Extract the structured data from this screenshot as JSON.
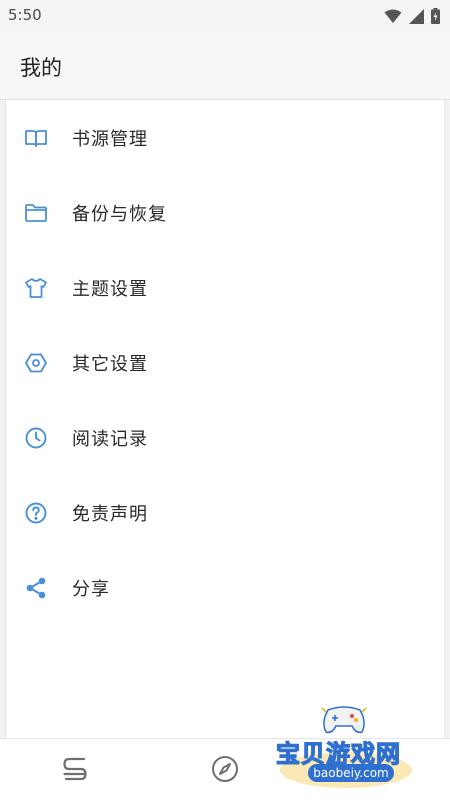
{
  "status_bar": {
    "time": "5:50"
  },
  "app_bar": {
    "title": "我的"
  },
  "menu": {
    "items": [
      {
        "label": "书源管理",
        "icon": "book-open-icon"
      },
      {
        "label": "备份与恢复",
        "icon": "folder-icon"
      },
      {
        "label": "主题设置",
        "icon": "tshirt-icon"
      },
      {
        "label": "其它设置",
        "icon": "hexagon-settings-icon"
      },
      {
        "label": "阅读记录",
        "icon": "clock-icon"
      },
      {
        "label": "免责声明",
        "icon": "help-circle-icon"
      },
      {
        "label": "分享",
        "icon": "share-icon"
      }
    ]
  },
  "bottom_nav": {
    "items": [
      {
        "icon": "bookshelf-icon"
      },
      {
        "icon": "compass-icon"
      }
    ]
  },
  "watermark": {
    "text": "宝贝游戏网",
    "url": "baobeiy.com"
  },
  "colors": {
    "accent": "#4a90d9",
    "icon_gray": "#6f6f6f"
  }
}
